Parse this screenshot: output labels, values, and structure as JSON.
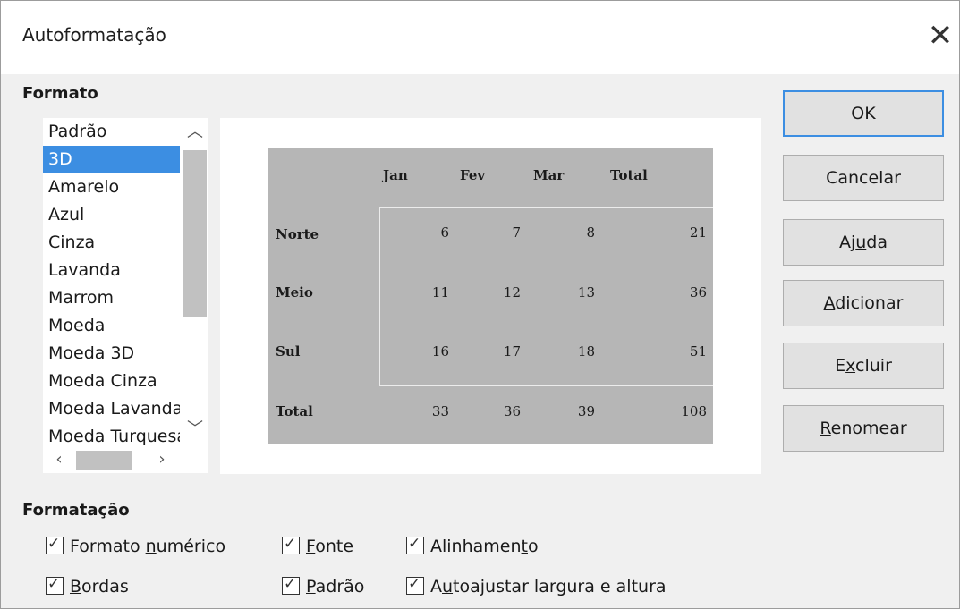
{
  "window": {
    "title": "Autoformatação"
  },
  "formato": {
    "title": "Formato",
    "items": [
      "Padrão",
      "3D",
      "Amarelo",
      "Azul",
      "Cinza",
      "Lavanda",
      "Marrom",
      "Moeda",
      "Moeda 3D",
      "Moeda Cinza",
      "Moeda Lavanda",
      "Moeda Turquesa"
    ],
    "selected": "3D"
  },
  "preview": {
    "headers": [
      "Jan",
      "Fev",
      "Mar",
      "Total"
    ],
    "rows": [
      {
        "label": "Norte",
        "values": [
          "6",
          "7",
          "8",
          "21"
        ]
      },
      {
        "label": "Meio",
        "values": [
          "11",
          "12",
          "13",
          "36"
        ]
      },
      {
        "label": "Sul",
        "values": [
          "16",
          "17",
          "18",
          "51"
        ]
      },
      {
        "label": "Total",
        "values": [
          "33",
          "36",
          "39",
          "108"
        ]
      }
    ],
    "background_color": "#b6b6b6"
  },
  "buttons": {
    "ok": "OK",
    "cancel": "Cancelar",
    "help": {
      "pre": "Aj",
      "key": "u",
      "post": "da"
    },
    "add": {
      "pre": "",
      "key": "A",
      "post": "dicionar"
    },
    "delete": {
      "pre": "E",
      "key": "x",
      "post": "cluir"
    },
    "rename": {
      "pre": "",
      "key": "R",
      "post": "enomear"
    }
  },
  "formatacao": {
    "title": "Formatação",
    "options": {
      "number_format": {
        "pre": "Formato ",
        "key": "n",
        "post": "umérico",
        "checked": true
      },
      "borders": {
        "pre": "",
        "key": "B",
        "post": "ordas",
        "checked": true
      },
      "font": {
        "pre": "",
        "key": "F",
        "post": "onte",
        "checked": true
      },
      "pattern": {
        "pre": "",
        "key": "P",
        "post": "adrão",
        "checked": true
      },
      "alignment": {
        "pre": "Alinhamen",
        "key": "t",
        "post": "o",
        "checked": true
      },
      "autofit": {
        "pre": "A",
        "key": "u",
        "post": "toajustar largura e altura",
        "checked": true
      }
    }
  },
  "colors": {
    "accent": "#3c8ee2",
    "dialog_bg": "#f0f0f0",
    "button_bg": "#e1e1e1"
  },
  "icons": {
    "close": "close-icon",
    "check": "check-icon"
  }
}
